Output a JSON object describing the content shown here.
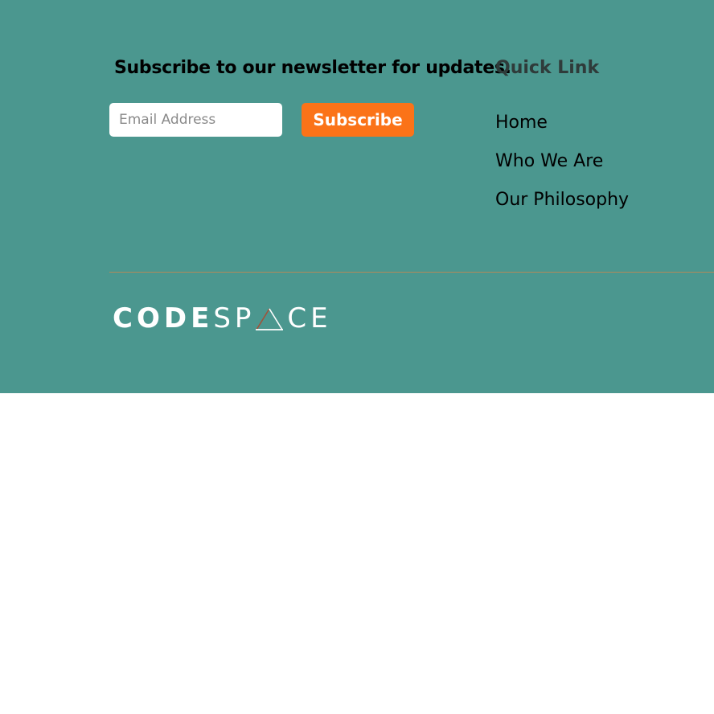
{
  "colors": {
    "footer_background": "#4b978f",
    "accent": "#fb7318",
    "logo_mark_accent": "#a0523a",
    "divider": "#b08a5a"
  },
  "newsletter": {
    "heading": "Subscribe to our newsletter for updates.",
    "email_placeholder": "Email Address",
    "email_value": "",
    "subscribe_label": "Subscribe"
  },
  "quick_links": {
    "heading": "Quick Link",
    "items": [
      {
        "label": "Home"
      },
      {
        "label": "Who We Are"
      },
      {
        "label": "Our Philosophy"
      }
    ]
  },
  "logo": {
    "text_bold": "CODE",
    "text_light_before": "SP",
    "text_light_after": "CE",
    "mark_icon": "triangle-icon"
  }
}
